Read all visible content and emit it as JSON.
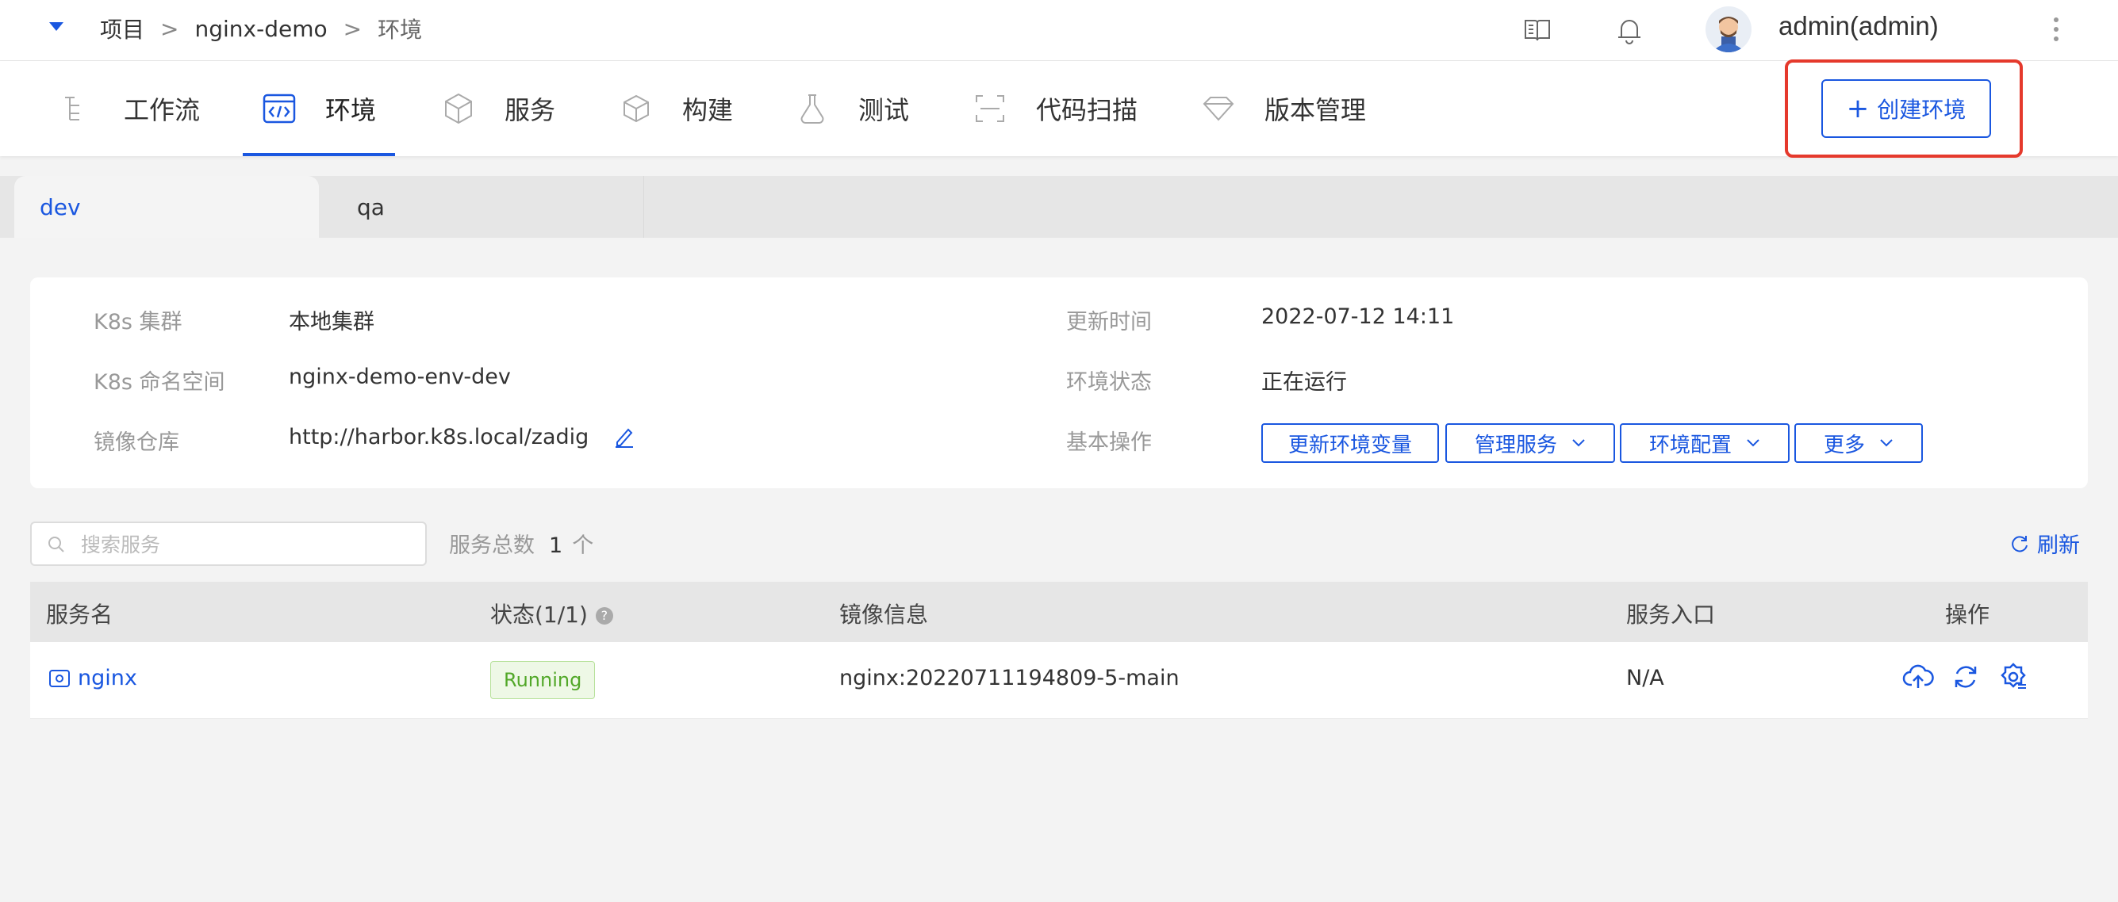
{
  "breadcrumb": {
    "project": "项目",
    "sep": ">",
    "project_name": "nginx-demo",
    "current": "环境"
  },
  "user": {
    "name": "admin(admin)"
  },
  "nav": {
    "tabs": [
      {
        "label": "工作流",
        "icon": "workflow-icon"
      },
      {
        "label": "环境",
        "icon": "environment-code-icon",
        "active": true
      },
      {
        "label": "服务",
        "icon": "service-cube-icon"
      },
      {
        "label": "构建",
        "icon": "build-box-icon"
      },
      {
        "label": "测试",
        "icon": "test-flask-icon"
      },
      {
        "label": "代码扫描",
        "icon": "code-scan-icon"
      },
      {
        "label": "版本管理",
        "icon": "version-diamond-icon"
      }
    ],
    "create_label": "创建环境"
  },
  "env_tabs": [
    {
      "label": "dev",
      "active": true
    },
    {
      "label": "qa"
    }
  ],
  "info": {
    "cluster_label": "K8s 集群",
    "cluster_value": "本地集群",
    "namespace_label": "K8s 命名空间",
    "namespace_value": "nginx-demo-env-dev",
    "registry_label": "镜像仓库",
    "registry_value": "http://harbor.k8s.local/zadig",
    "updated_label": "更新时间",
    "updated_value": "2022-07-12 14:11",
    "status_label": "环境状态",
    "status_value": "正在运行",
    "ops_label": "基本操作",
    "ops": {
      "update_vars": "更新环境变量",
      "manage_services": "管理服务",
      "env_config": "环境配置",
      "more": "更多"
    }
  },
  "services": {
    "search_placeholder": "搜索服务",
    "total_label": "服务总数",
    "total_count": "1",
    "total_unit": "个",
    "refresh_label": "刷新",
    "columns": {
      "name": "服务名",
      "status": "状态(1/1)",
      "image": "镜像信息",
      "entry": "服务入口",
      "actions": "操作"
    },
    "rows": [
      {
        "name": "nginx",
        "status": "Running",
        "image": "nginx:20220711194809-5-main",
        "entry": "N/A"
      }
    ]
  },
  "colors": {
    "accent": "#1a57e0",
    "highlight": "#e5392c",
    "running_text": "#52a829"
  }
}
